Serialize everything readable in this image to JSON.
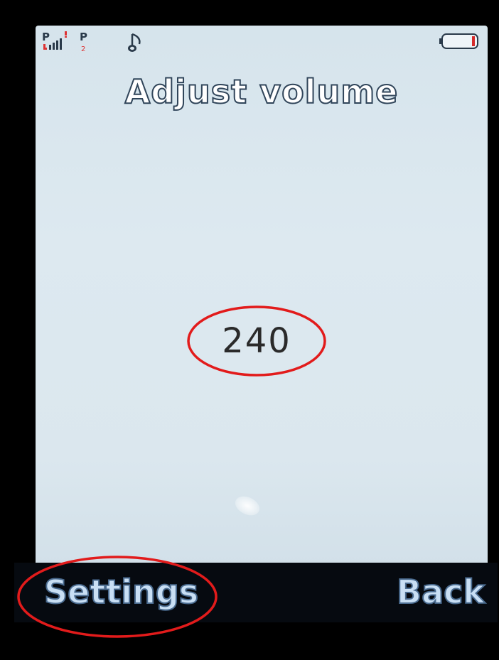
{
  "screen": {
    "title": "Adjust volume",
    "volume_value": "240"
  },
  "status_bar": {
    "sim1_label": "P",
    "sim2_label": "P",
    "sim2_number": "2",
    "icons": [
      "signal-icon",
      "music-note-icon",
      "battery-icon"
    ]
  },
  "softkeys": {
    "left_label": "Settings",
    "right_label": "Back"
  },
  "colors": {
    "screen_bg": "#dbe7ee",
    "title_outline": "#30455a",
    "highlight_circle": "#e21b1b",
    "softkey_text": "#c9dff4",
    "battery_level": "#d42a2a"
  }
}
